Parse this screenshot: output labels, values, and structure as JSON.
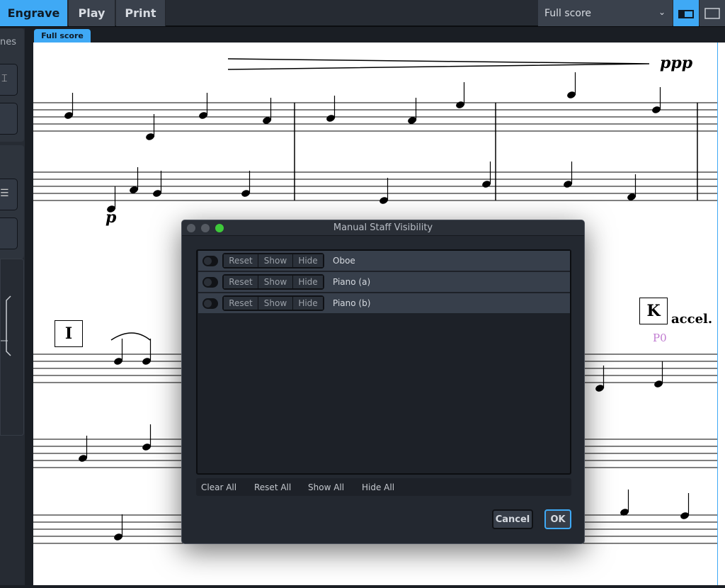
{
  "modes": [
    {
      "label": "Engrave",
      "active": true
    },
    {
      "label": "Play",
      "active": false
    },
    {
      "label": "Print",
      "active": false
    }
  ],
  "layout_selector": {
    "value": "Full score",
    "icon": "chevron-down-icon"
  },
  "view_buttons": [
    {
      "icon": "galley-view-icon",
      "active": true
    },
    {
      "icon": "page-view-icon",
      "active": false
    }
  ],
  "tab": {
    "label": "Full score"
  },
  "left_panel": {
    "partial_label": "nes"
  },
  "score": {
    "dynamics": [
      "ppp",
      "p"
    ],
    "rehearsal_marks": [
      "I",
      "K"
    ],
    "tempo": "accel.",
    "page_label": "P0",
    "page_label_color": "#c07ad0"
  },
  "dialog": {
    "title": "Manual Staff Visibility",
    "rows": [
      {
        "label": "Oboe",
        "buttons": [
          "Reset",
          "Show",
          "Hide"
        ]
      },
      {
        "label": "Piano (a)",
        "buttons": [
          "Reset",
          "Show",
          "Hide"
        ]
      },
      {
        "label": "Piano (b)",
        "buttons": [
          "Reset",
          "Show",
          "Hide"
        ]
      }
    ],
    "bulk_actions": [
      "Clear All",
      "Reset All",
      "Show All",
      "Hide All"
    ],
    "cancel_label": "Cancel",
    "ok_label": "OK"
  },
  "colors": {
    "accent": "#3fa9f5",
    "panel": "#262b33",
    "dialog": "#232830"
  }
}
